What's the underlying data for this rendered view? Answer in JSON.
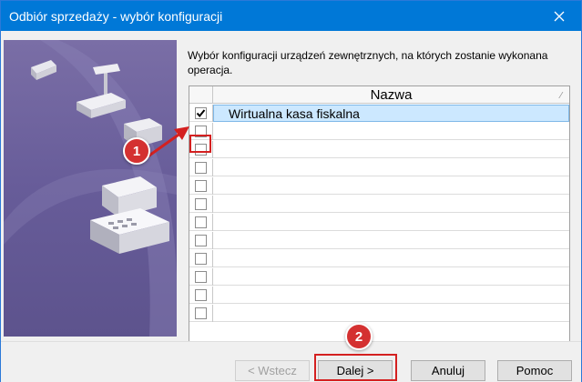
{
  "window": {
    "title": "Odbiór sprzedaży - wybór konfiguracji",
    "close_glyph": "✕"
  },
  "instruction": "Wybór konfiguracji urządzeń zewnętrznych, na których zostanie wykonana operacja.",
  "grid": {
    "column_header": "Nazwa",
    "sort_glyph": "⁄",
    "rows": [
      {
        "label": "Wirtualna kasa fiskalna",
        "checked": true,
        "selected": true
      },
      {
        "label": "",
        "checked": false
      },
      {
        "label": "",
        "checked": false
      },
      {
        "label": "",
        "checked": false
      },
      {
        "label": "",
        "checked": false
      },
      {
        "label": "",
        "checked": false
      },
      {
        "label": "",
        "checked": false
      },
      {
        "label": "",
        "checked": false
      },
      {
        "label": "",
        "checked": false
      },
      {
        "label": "",
        "checked": false
      },
      {
        "label": "",
        "checked": false
      },
      {
        "label": "",
        "checked": false
      }
    ]
  },
  "annotations": {
    "step1": "1",
    "step2": "2",
    "highlight_color": "#d42020"
  },
  "buttons": {
    "back": "< Wstecz",
    "next": "Dalej >",
    "cancel": "Anuluj",
    "help": "Pomoc"
  },
  "colors": {
    "titlebar": "#0078d7",
    "selection": "#cce8ff",
    "side_panel": "#6b5f9c"
  }
}
